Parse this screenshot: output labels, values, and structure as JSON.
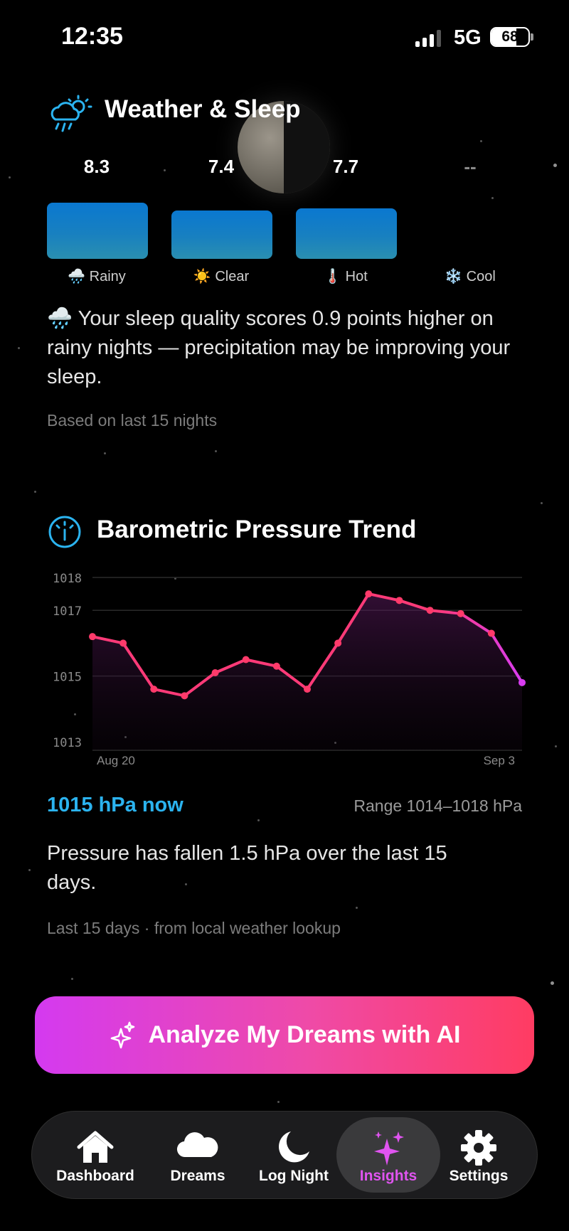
{
  "status": {
    "time": "12:35",
    "network": "5G",
    "battery": "68",
    "battery_level": 68
  },
  "weather": {
    "title": "Weather & Sleep",
    "scores": [
      {
        "label": "8.3",
        "value": 8.3,
        "category": "Rainy",
        "icon": "🌧️"
      },
      {
        "label": "7.4",
        "value": 7.4,
        "category": "Clear",
        "icon": "☀️"
      },
      {
        "label": "7.7",
        "value": 7.7,
        "category": "Hot",
        "icon": "🌡️"
      },
      {
        "label": "--",
        "value": null,
        "category": "Cool",
        "icon": "❄️"
      }
    ],
    "insight": "🌧️ Your sleep quality scores 0.9 points higher on rainy nights — precipitation may be improving your sleep.",
    "footnote": "Based on last 15 nights"
  },
  "pressure": {
    "title": "Barometric Pressure Trend",
    "now": "1015 hPa now",
    "range": "Range 1014–1018 hPa",
    "summary": "Pressure has fallen 1.5 hPa over the last 15 days.",
    "footnote": "Last 15 days · from local weather lookup"
  },
  "chart_data": {
    "type": "line",
    "x_start_label": "Aug 20",
    "x_end_label": "Sep 3",
    "y_ticks": [
      1018,
      1017,
      1015,
      1013
    ],
    "ylim": [
      1013,
      1018
    ],
    "values": [
      1016.2,
      1016.0,
      1014.6,
      1014.4,
      1015.1,
      1015.5,
      1015.3,
      1014.6,
      1016.0,
      1017.5,
      1017.3,
      1017.0,
      1016.9,
      1016.3,
      1014.8
    ],
    "colors": {
      "line_start": "#ff3a78",
      "line_end": "#d83cf0",
      "point": "#ff3a6a"
    }
  },
  "actions": {
    "analyze_label": "Analyze My Dreams with AI"
  },
  "tabs": [
    {
      "label": "Dashboard",
      "icon": "house-icon"
    },
    {
      "label": "Dreams",
      "icon": "cloud-icon"
    },
    {
      "label": "Log Night",
      "icon": "moon-icon"
    },
    {
      "label": "Insights",
      "icon": "sparkles-icon",
      "active": true
    },
    {
      "label": "Settings",
      "icon": "gear-icon"
    }
  ],
  "colors": {
    "accent_blue": "#2bb3ef",
    "accent_pink": "#e054f0",
    "bar_blue": "#0a78d0"
  }
}
